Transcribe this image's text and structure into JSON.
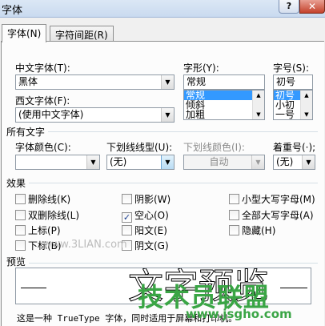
{
  "window": {
    "title": "字体",
    "help_label": "?",
    "close_label": "✕"
  },
  "tabs": [
    {
      "label": "字体(N)",
      "active": true
    },
    {
      "label": "字符间距(R)",
      "active": false
    }
  ],
  "font": {
    "chinese_label": "中文字体(T):",
    "chinese_value": "黑体",
    "western_label": "西文字体(F):",
    "western_value": "(使用中文字体)",
    "style_label": "字形(Y):",
    "style_value": "常规",
    "style_options": [
      "常规",
      "倾斜",
      "加粗"
    ],
    "size_label": "字号(S):",
    "size_value": "初号",
    "size_options": [
      "初号",
      "小初",
      "一号"
    ]
  },
  "all_text": {
    "section_label": "所有文字",
    "color_label": "字体颜色(C):",
    "color_value": "",
    "underline_label": "下划线线型(U):",
    "underline_value": "(无)",
    "underline_color_label": "下划线颜色(I):",
    "underline_color_value": "自动",
    "emphasis_label": "着重号(·);",
    "emphasis_value": "(无)"
  },
  "effects": {
    "section_label": "效果",
    "col1": [
      {
        "label": "删除线(K)",
        "checked": false
      },
      {
        "label": "双删除线(L)",
        "checked": false
      },
      {
        "label": "上标(P)",
        "checked": false
      },
      {
        "label": "下标(B)",
        "checked": false
      }
    ],
    "col2": [
      {
        "label": "阴影(W)",
        "checked": false
      },
      {
        "label": "空心(O)",
        "checked": true
      },
      {
        "label": "阳文(E)",
        "checked": false
      },
      {
        "label": "阴文(G)",
        "checked": false
      }
    ],
    "col3": [
      {
        "label": "小型大写字母(M)",
        "checked": false
      },
      {
        "label": "全部大写字母(A)",
        "checked": false
      },
      {
        "label": "隐藏(H)",
        "checked": false
      }
    ]
  },
  "preview": {
    "section_label": "预览",
    "sample": "文字预览",
    "hint": "这是一种 TrueType 字体，同时适用于屏幕和打印机。"
  },
  "watermarks": {
    "top": "www.3LIAN.com",
    "brand": "技术员联盟",
    "url": "www.jsgho.com"
  }
}
